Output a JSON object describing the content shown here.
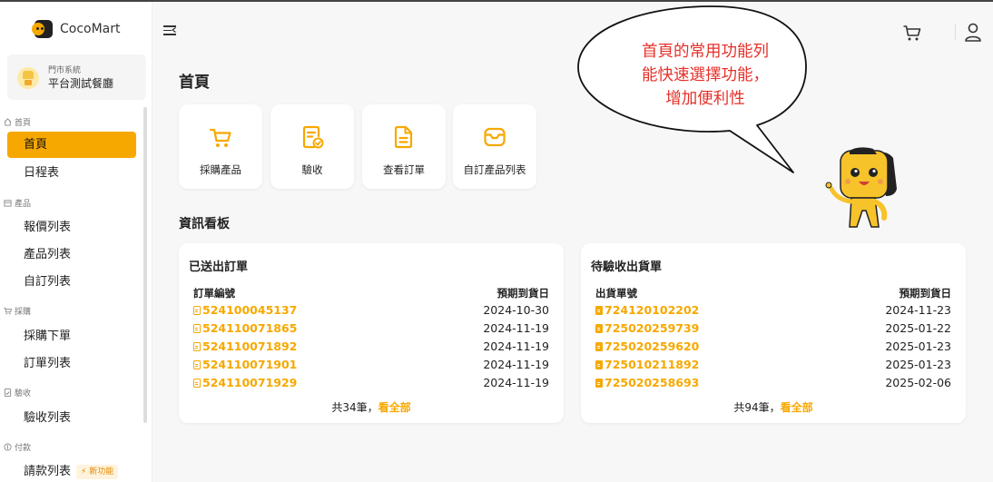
{
  "brand": {
    "name": "CocoMart"
  },
  "store": {
    "label": "門市系統",
    "name": "平台測試餐廳"
  },
  "sidebar": {
    "sections": [
      {
        "label": "首頁"
      },
      {
        "label": "產品"
      },
      {
        "label": "採購"
      },
      {
        "label": "驗收"
      },
      {
        "label": "付款"
      }
    ],
    "items": [
      {
        "label": "首頁"
      },
      {
        "label": "日程表"
      },
      {
        "label": "報價列表"
      },
      {
        "label": "產品列表"
      },
      {
        "label": "自訂列表"
      },
      {
        "label": "採購下單"
      },
      {
        "label": "訂單列表"
      },
      {
        "label": "驗收列表"
      },
      {
        "label": "請款列表",
        "badge": "新功能"
      }
    ]
  },
  "main": {
    "title": "首頁",
    "quick_actions": [
      {
        "label": "採購產品",
        "icon": "cart-icon"
      },
      {
        "label": "驗收",
        "icon": "check-document-icon"
      },
      {
        "label": "查看訂單",
        "icon": "document-icon"
      },
      {
        "label": "自訂產品列表",
        "icon": "inbox-icon"
      }
    ],
    "board_title": "資訊看板",
    "sent_orders": {
      "title": "已送出訂單",
      "col_id": "訂單編號",
      "col_date": "預期到貨日",
      "rows": [
        {
          "id": "524100045137",
          "date": "2024-10-30"
        },
        {
          "id": "524110071865",
          "date": "2024-11-19"
        },
        {
          "id": "524110071892",
          "date": "2024-11-19"
        },
        {
          "id": "524110071901",
          "date": "2024-11-19"
        },
        {
          "id": "524110071929",
          "date": "2024-11-19"
        }
      ],
      "total": "共34筆，",
      "see_all": "看全部"
    },
    "pending_receipts": {
      "title": "待驗收出貨單",
      "col_id": "出貨單號",
      "col_date": "預期到貨日",
      "rows": [
        {
          "id": "724120102202",
          "date": "2024-11-23"
        },
        {
          "id": "725020259739",
          "date": "2025-01-22"
        },
        {
          "id": "725020259620",
          "date": "2025-01-23"
        },
        {
          "id": "725010211892",
          "date": "2025-01-23"
        },
        {
          "id": "725020258693",
          "date": "2025-02-06"
        }
      ],
      "total": "共94筆，",
      "see_all": "看全部"
    }
  },
  "callout": {
    "line1": "首頁的常用功能列",
    "line2": "能快速選擇功能，",
    "line3": "增加便利性"
  },
  "colors": {
    "accent": "#f7a800",
    "callout_text": "#e6302a"
  }
}
